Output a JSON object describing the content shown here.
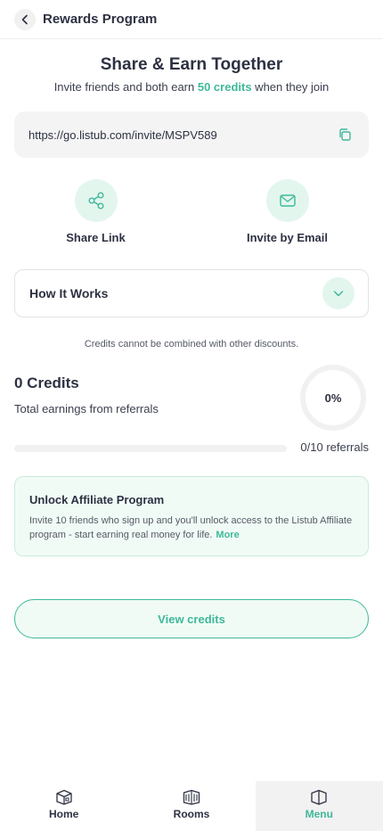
{
  "header": {
    "title": "Rewards Program",
    "back_icon": "chevron-left-icon"
  },
  "hero": {
    "title": "Share & Earn Together",
    "subtitle_prefix": "Invite friends and both earn ",
    "subtitle_highlight": "50 credits",
    "subtitle_suffix": " when they join"
  },
  "invite": {
    "link": "https://go.listub.com/invite/MSPV589",
    "copy_icon": "copy-icon"
  },
  "share_options": [
    {
      "label": "Share Link",
      "icon": "share-icon"
    },
    {
      "label": "Invite by Email",
      "icon": "mail-icon"
    }
  ],
  "how_it_works": {
    "title": "How It Works",
    "icon": "chevron-down-icon"
  },
  "note": "Credits cannot be combined with other discounts.",
  "credits": {
    "amount": "0 Credits",
    "label": "Total earnings from referrals",
    "percent_text": "0%",
    "progress_fraction": 0,
    "progress_text": "0/10 referrals"
  },
  "affiliate": {
    "title": "Unlock Affiliate Program",
    "body": "Invite 10 friends who sign up and you'll unlock access to the Listub Affiliate program - start earning real money for life.",
    "more": "More"
  },
  "view_credits_label": "View credits",
  "tabbar": [
    {
      "label": "Home",
      "icon": "home-box-icon",
      "active": false
    },
    {
      "label": "Rooms",
      "icon": "rooms-icon",
      "active": false
    },
    {
      "label": "Menu",
      "icon": "menu-box-icon",
      "active": true
    }
  ],
  "colors": {
    "accent": "#3fb89a",
    "accent_light": "#e3f6ee",
    "text": "#2d3142"
  }
}
